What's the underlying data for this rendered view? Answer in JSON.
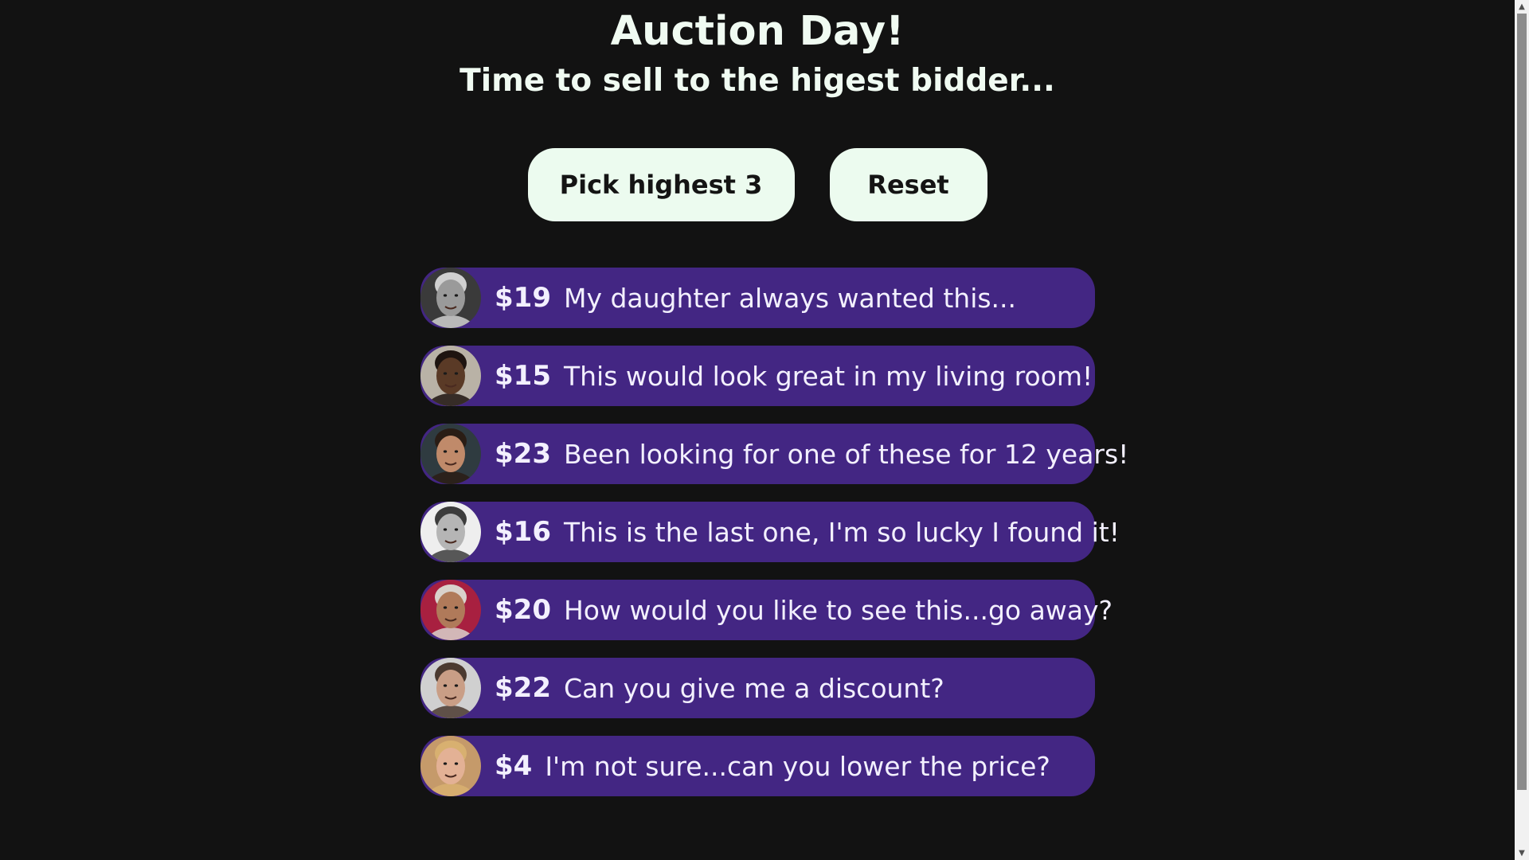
{
  "header": {
    "title": "Auction Day!",
    "subtitle": "Time to sell to the higest bidder..."
  },
  "buttons": {
    "pick_label": "Pick highest 3",
    "reset_label": "Reset"
  },
  "bids": [
    {
      "amount": "$19",
      "message": "My daughter always wanted this...",
      "avatar": "elderly-man-bw",
      "skin": "#9a9a9a",
      "hair": "#d0d0d0",
      "bg": "#3a3a3a"
    },
    {
      "amount": "$15",
      "message": "This would look great in my living room!",
      "avatar": "smiling-man",
      "skin": "#5a3a26",
      "hair": "#1e1410",
      "bg": "#b9b2a6"
    },
    {
      "amount": "$23",
      "message": "Been looking for one of these for 12 years!",
      "avatar": "bearded-man",
      "skin": "#c08a6a",
      "hair": "#2a1d15",
      "bg": "#2f3b40"
    },
    {
      "amount": "$16",
      "message": "This is the last one, I'm so lucky I found it!",
      "avatar": "man-bw",
      "skin": "#b5b5b5",
      "hair": "#3c3c3c",
      "bg": "#eeeeee"
    },
    {
      "amount": "$20",
      "message": "How would you like to see this...go away?",
      "avatar": "elderly-woman",
      "skin": "#b07a5a",
      "hair": "#d9d2cc",
      "bg": "#a82040"
    },
    {
      "amount": "$22",
      "message": "Can you give me a discount?",
      "avatar": "middle-aged-man",
      "skin": "#c99e86",
      "hair": "#4b3a30",
      "bg": "#d0d0d0"
    },
    {
      "amount": "$4",
      "message": "I'm not sure...can you lower the price?",
      "avatar": "blonde-woman",
      "skin": "#e3b195",
      "hair": "#d8b070",
      "bg": "#c59a6a"
    }
  ],
  "colors": {
    "background": "#121212",
    "bid_row": "#432683",
    "button": "#ecfbef"
  }
}
